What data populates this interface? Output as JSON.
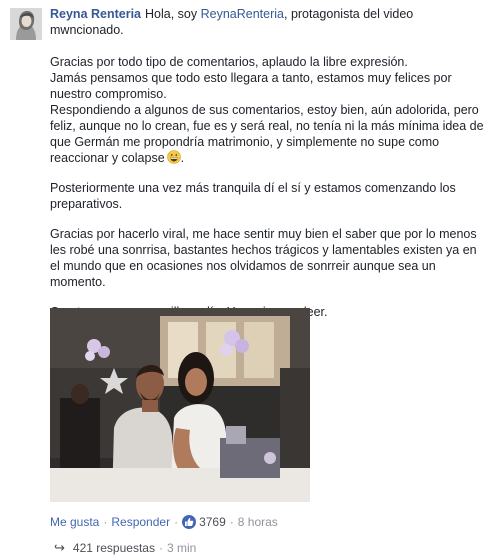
{
  "comment": {
    "author": "Reyna Renteria",
    "intro_text": "Hola, soy",
    "mention": "ReynaRenteria",
    "intro_rest_1": ", protagonista del video",
    "intro_rest_2": "mwncionado.",
    "p1_lines": [
      "Gracias por todo tipo de comentarios, aplaudo la libre expresión.",
      "Jamás pensamos que todo esto llegara a tanto, estamos muy felices por",
      "nuestro compromiso.",
      "Respondiendo a algunos de sus comentarios, estoy bien, aún adolorida, pero",
      "feliz, aunque no lo crean, fue es y será real, no tenía ni la más mínima idea de",
      "que Germán me propondría matrimonio, y simplemente no supe como",
      "reaccionar y colapse"
    ],
    "p2_lines": [
      "Posteriormente una vez más tranquila dí el sí y estamos comenzando los",
      "preparativos."
    ],
    "p3_lines": [
      "Gracias por hacerlo viral, me hace sentir muy bien el saber que por lo menos",
      "les robé una sonrrisa, bastantes hechos trágicos y lamentables existen ya en",
      "el mundo que en ocasiones nos olvidamos de sonrreir aunque sea un",
      "momento."
    ],
    "p4": "Que tengan un maravilloso día. Y gracias por leer.",
    "emoji_icon": "grinning-face-emoji"
  },
  "actions": {
    "like": "Me gusta",
    "dot1": "·",
    "reply": "Responder",
    "dot2": "·",
    "like_count": "3769",
    "dot3": "·",
    "time": "8 horas"
  },
  "replies": {
    "arrow": "↪",
    "count_label": "421 respuestas",
    "dot": "·",
    "time": "3 min"
  },
  "colors": {
    "link": "#365899",
    "meta": "#90949c",
    "like_blue": "#4267b2"
  }
}
